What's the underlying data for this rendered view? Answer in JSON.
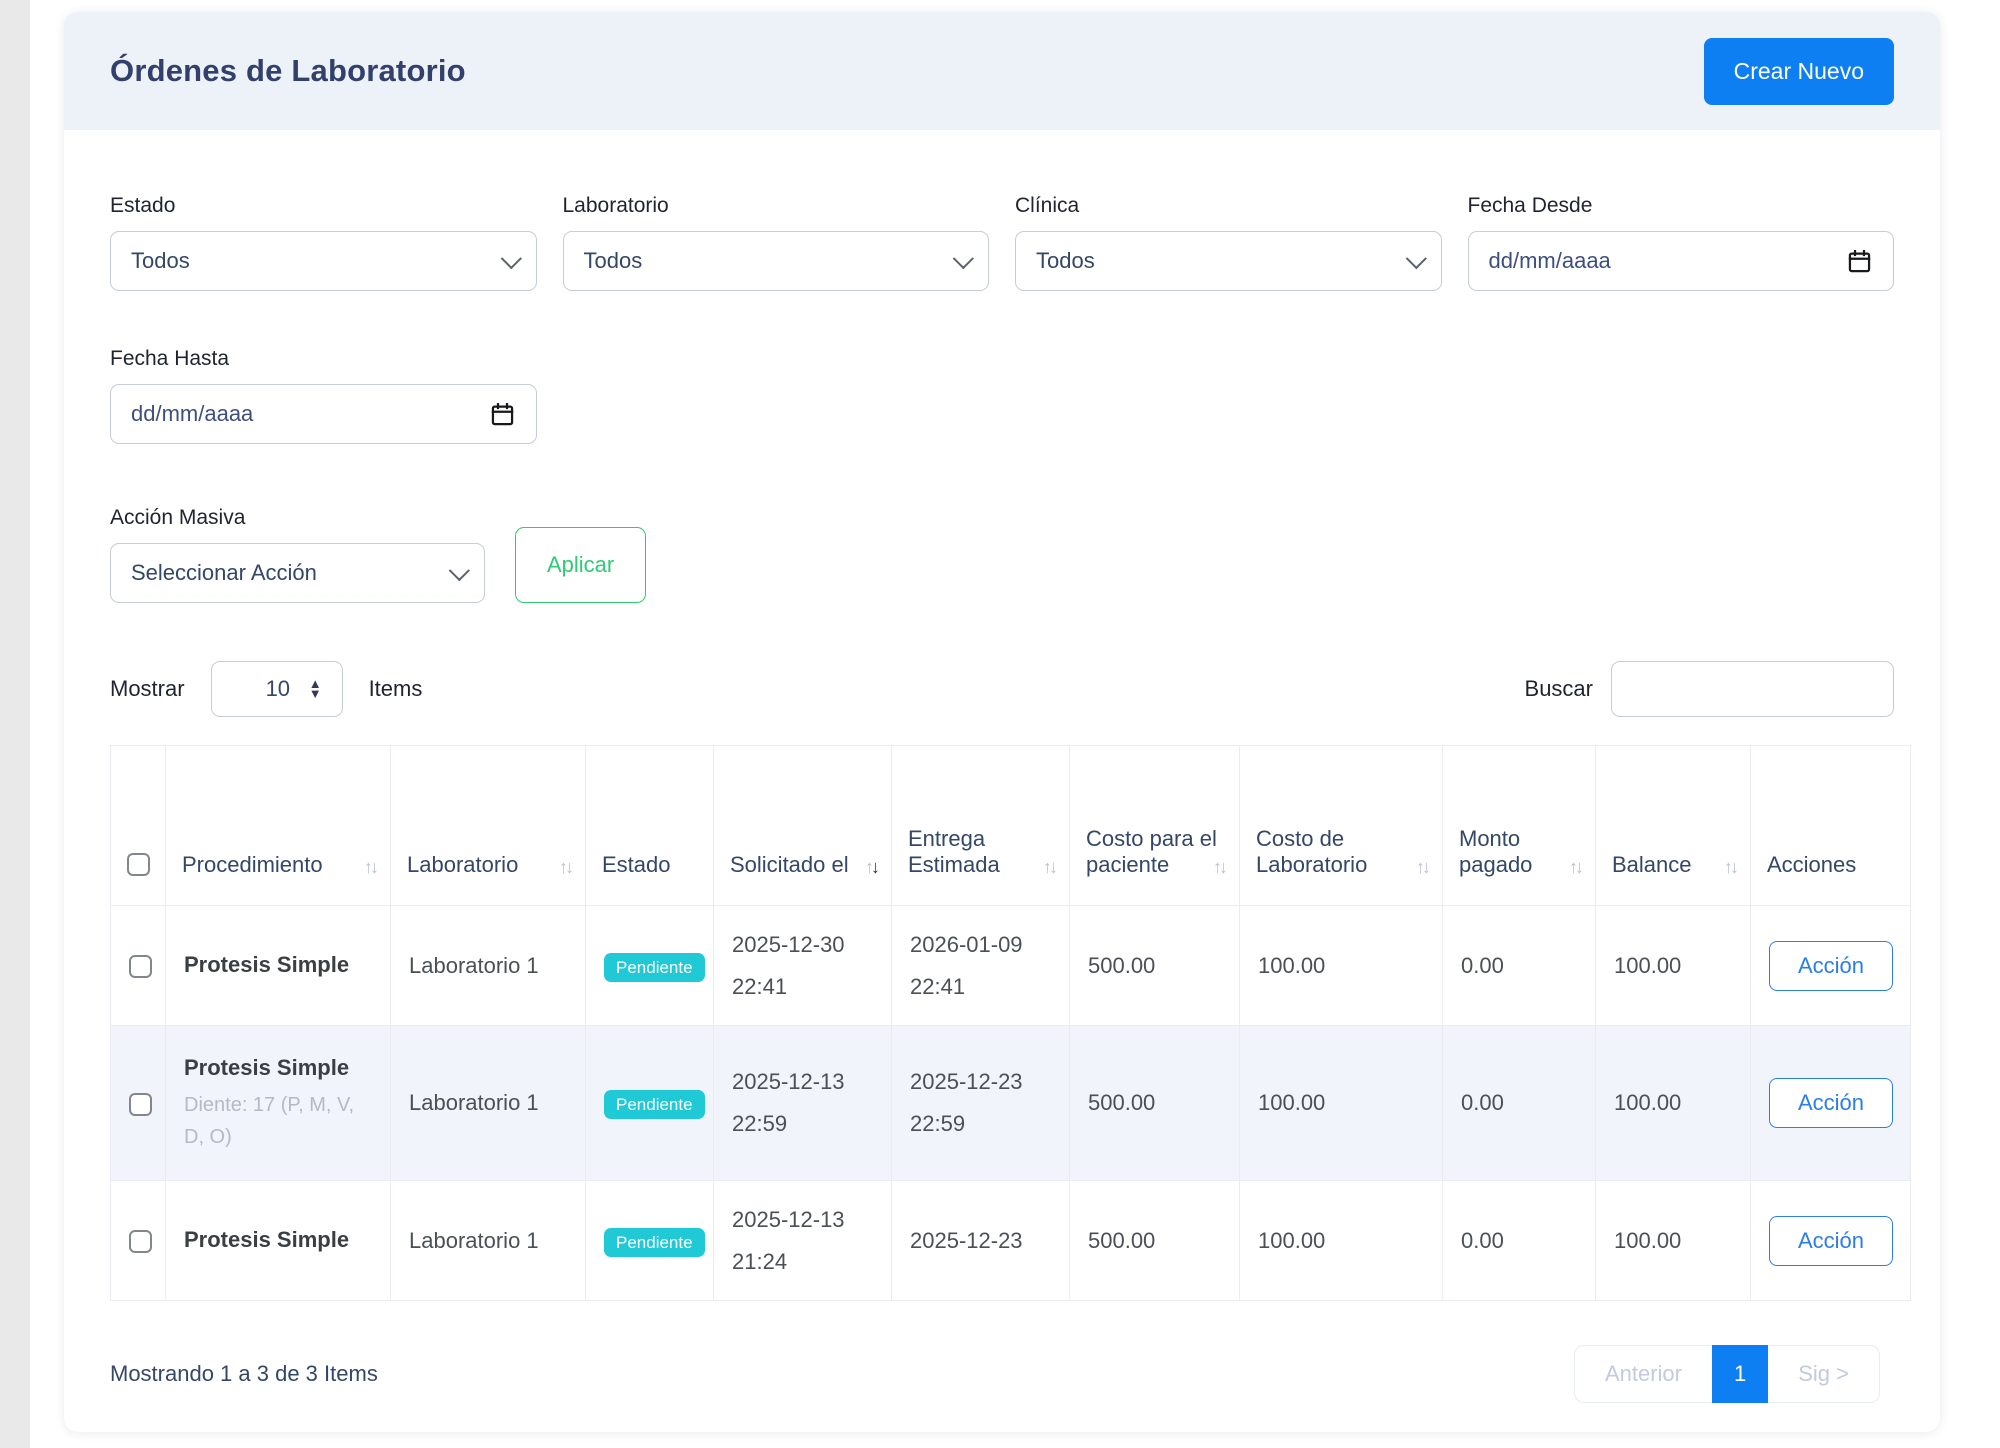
{
  "page": {
    "title": "Órdenes de Laboratorio",
    "create_button": "Crear Nuevo"
  },
  "filters": {
    "estado": {
      "label": "Estado",
      "value": "Todos"
    },
    "laboratorio": {
      "label": "Laboratorio",
      "value": "Todos"
    },
    "clinica": {
      "label": "Clínica",
      "value": "Todos"
    },
    "fecha_desde": {
      "label": "Fecha Desde",
      "placeholder": "dd/mm/aaaa"
    },
    "fecha_hasta": {
      "label": "Fecha Hasta",
      "placeholder": "dd/mm/aaaa"
    }
  },
  "bulk_action": {
    "label": "Acción Masiva",
    "value": "Seleccionar Acción",
    "apply_button": "Aplicar"
  },
  "list_controls": {
    "show_label": "Mostrar",
    "page_size": "10",
    "items_label": "Items",
    "search_label": "Buscar",
    "search_value": ""
  },
  "table": {
    "columns": [
      {
        "label": "Procedimiento",
        "sortable": true,
        "sort": null
      },
      {
        "label": "Laboratorio",
        "sortable": true,
        "sort": null
      },
      {
        "label": "Estado",
        "sortable": false,
        "sort": null
      },
      {
        "label": "Solicitado el",
        "sortable": true,
        "sort": "desc"
      },
      {
        "label": "Entrega Estimada",
        "sortable": true,
        "sort": null
      },
      {
        "label": "Costo para el paciente",
        "sortable": true,
        "sort": null
      },
      {
        "label": "Costo de Laboratorio",
        "sortable": true,
        "sort": null
      },
      {
        "label": "Monto pagado",
        "sortable": true,
        "sort": null
      },
      {
        "label": "Balance",
        "sortable": true,
        "sort": null
      },
      {
        "label": "Acciones",
        "sortable": false,
        "sort": null
      }
    ],
    "rows": [
      {
        "procedure": "Protesis Simple",
        "note": "",
        "laboratory": "Laboratorio 1",
        "status": "Pendiente",
        "requested_date": "2025-12-30",
        "requested_time": "22:41",
        "delivery_date": "2026-01-09",
        "delivery_time": "22:41",
        "patient_cost": "500.00",
        "lab_cost": "100.00",
        "paid": "0.00",
        "balance": "100.00",
        "action": "Acción"
      },
      {
        "procedure": "Protesis Simple",
        "note": "Diente: 17 (P, M, V, D, O)",
        "laboratory": "Laboratorio 1",
        "status": "Pendiente",
        "requested_date": "2025-12-13",
        "requested_time": "22:59",
        "delivery_date": "2025-12-23",
        "delivery_time": "22:59",
        "patient_cost": "500.00",
        "lab_cost": "100.00",
        "paid": "0.00",
        "balance": "100.00",
        "action": "Acción"
      },
      {
        "procedure": "Protesis Simple",
        "note": "",
        "laboratory": "Laboratorio 1",
        "status": "Pendiente",
        "requested_date": "2025-12-13",
        "requested_time": "21:24",
        "delivery_date": "2025-12-23",
        "delivery_time": "",
        "patient_cost": "500.00",
        "lab_cost": "100.00",
        "paid": "0.00",
        "balance": "100.00",
        "action": "Acción"
      }
    ]
  },
  "footer": {
    "summary": "Mostrando 1 a 3 de 3 Items",
    "pagination": {
      "prev": "Anterior",
      "page": "1",
      "next": "Sig >"
    }
  },
  "colors": {
    "primary_blue": "#0d7ff2",
    "action_blue": "#2b7de9",
    "green": "#2fca73",
    "badge_cyan": "#1fc9d6",
    "title_navy": "#32406b",
    "header_bg": "#edf1f8",
    "stripe_bg": "#f1f4fa"
  }
}
